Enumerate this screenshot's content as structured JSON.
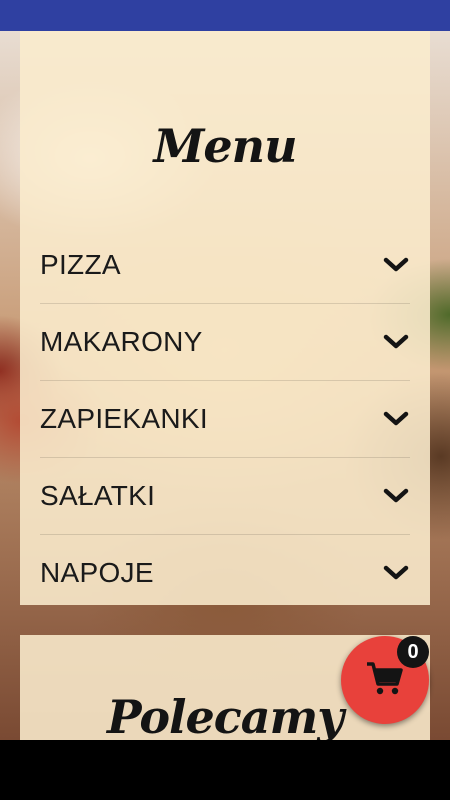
{
  "menu": {
    "title": "Menu",
    "items": [
      {
        "label": "PIZZA",
        "icon": "chevron-down-icon"
      },
      {
        "label": "MAKARONY",
        "icon": "chevron-down-icon"
      },
      {
        "label": "ZAPIEKANKI",
        "icon": "chevron-down-icon"
      },
      {
        "label": "SAŁATKI",
        "icon": "chevron-down-icon"
      },
      {
        "label": "NAPOJE",
        "icon": "chevron-down-icon"
      }
    ]
  },
  "recommended": {
    "title": "Polecamy"
  },
  "cart": {
    "icon": "cart-icon",
    "count": "0",
    "color": "#e8413b"
  },
  "colors": {
    "status_bar": "#2f40a1",
    "card_background": "#faeccd",
    "text": "#1a1a1a"
  }
}
